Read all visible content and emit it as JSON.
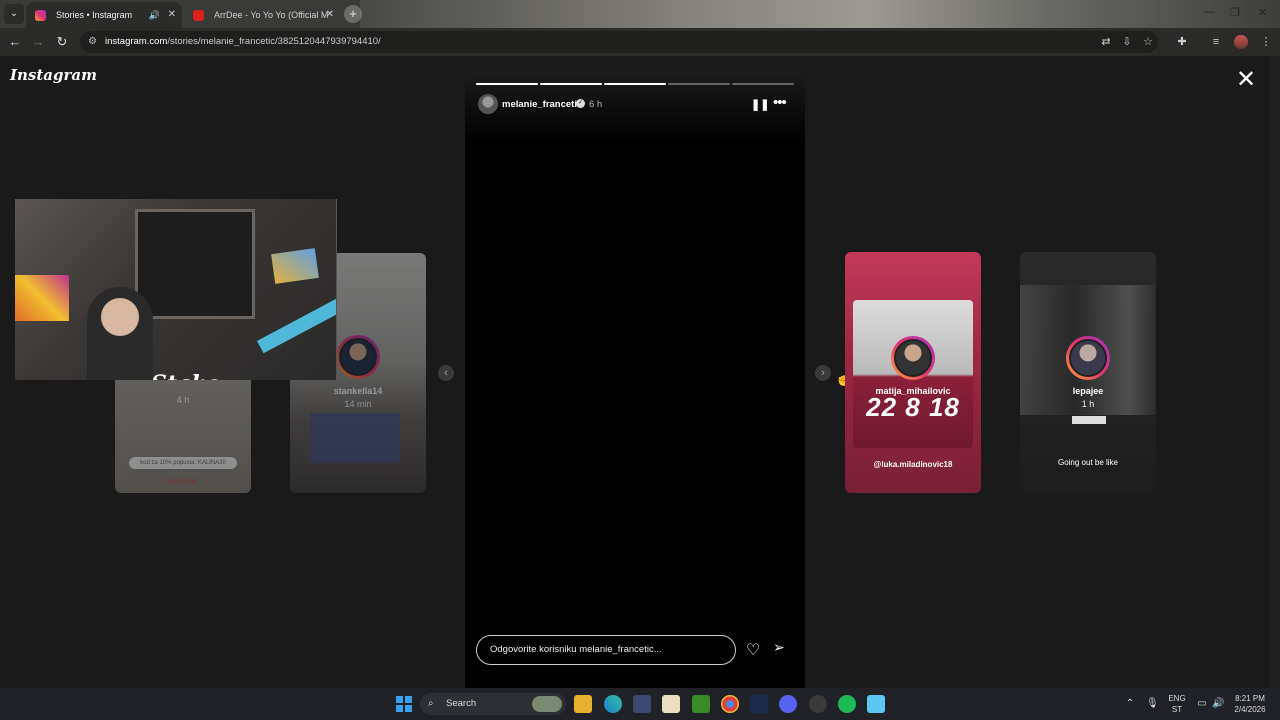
{
  "browser": {
    "tabs": [
      {
        "title": "Stories • Instagram",
        "active": true,
        "favicon": "instagram-icon",
        "audio": true
      },
      {
        "title": "ArrDee - Yo Yo Yo (Official M",
        "active": false,
        "favicon": "youtube-icon"
      }
    ],
    "new_tab_label": "+",
    "url_host": "instagram.com",
    "url_path": "/stories/melanie_francetic/3825120447939794410/"
  },
  "page": {
    "logo": "Instagram",
    "close_label": "✕"
  },
  "story": {
    "username": "melanie_francetic",
    "verified": true,
    "time": "6 h",
    "segments": [
      1,
      1,
      1,
      0,
      0
    ],
    "reply_placeholder": "Odgovorite korisniku melanie_francetic..."
  },
  "side_stories": [
    {
      "username": "",
      "time": "4 h",
      "promo": "kod za 10% popusta: KALINA30",
      "promo_title": "KUPON"
    },
    {
      "username": "stankella14",
      "time": "14 min"
    },
    {
      "username": "matija_mihailovic",
      "time": "",
      "headline": "22 8 18",
      "tag": "@luka.miladinovic18"
    },
    {
      "username": "lepajee",
      "time": "1 h",
      "caption": "Going out be like"
    }
  ],
  "stream_overlay": {
    "brand": "Stake"
  },
  "taskbar": {
    "search_label": "Search",
    "lang_top": "ENG",
    "lang_bottom": "ST",
    "clock_time": "8:21 PM",
    "clock_date": "2/4/2026"
  },
  "colors": {
    "progress_fill": "#ffffff",
    "ig_gradient_start": "#f9a13a",
    "ig_gradient_end": "#a235c7"
  }
}
